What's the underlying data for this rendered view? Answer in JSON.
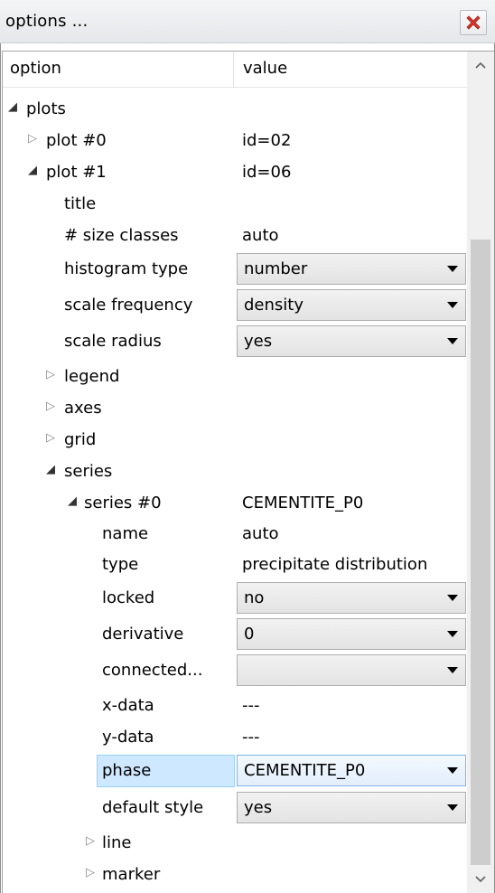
{
  "window": {
    "title": "options ...",
    "close_icon": "close-red-x-icon"
  },
  "columns": {
    "option": "option",
    "value": "value"
  },
  "tree": {
    "plots": "plots",
    "plot0": {
      "label": "plot #0",
      "value": "id=02"
    },
    "plot1": {
      "label": "plot #1",
      "value": "id=06",
      "title": {
        "label": "title",
        "value": ""
      },
      "size_classes": {
        "label": "# size classes",
        "value": "auto"
      },
      "histogram_type": {
        "label": "histogram type",
        "value": "number"
      },
      "scale_frequency": {
        "label": "scale frequency",
        "value": "density"
      },
      "scale_radius": {
        "label": "scale radius",
        "value": "yes"
      },
      "legend": "legend",
      "axes": "axes",
      "grid": "grid",
      "series": {
        "label": "series",
        "series0": {
          "label": "series #0",
          "value": "CEMENTITE_P0",
          "name": {
            "label": "name",
            "value": "auto"
          },
          "type": {
            "label": "type",
            "value": "precipitate distribution"
          },
          "locked": {
            "label": "locked",
            "value": "no"
          },
          "derivative": {
            "label": "derivative",
            "value": "0"
          },
          "connected": {
            "label": "connected...",
            "value": ""
          },
          "xdata": {
            "label": "x-data",
            "value": "---"
          },
          "ydata": {
            "label": "y-data",
            "value": "---"
          },
          "phase": {
            "label": "phase",
            "value": "CEMENTITE_P0"
          },
          "default_style": {
            "label": "default style",
            "value": "yes"
          },
          "line": "line",
          "marker": "marker"
        }
      }
    }
  },
  "colors": {
    "selection": "#cde8ff",
    "close_red": "#e0352b"
  }
}
